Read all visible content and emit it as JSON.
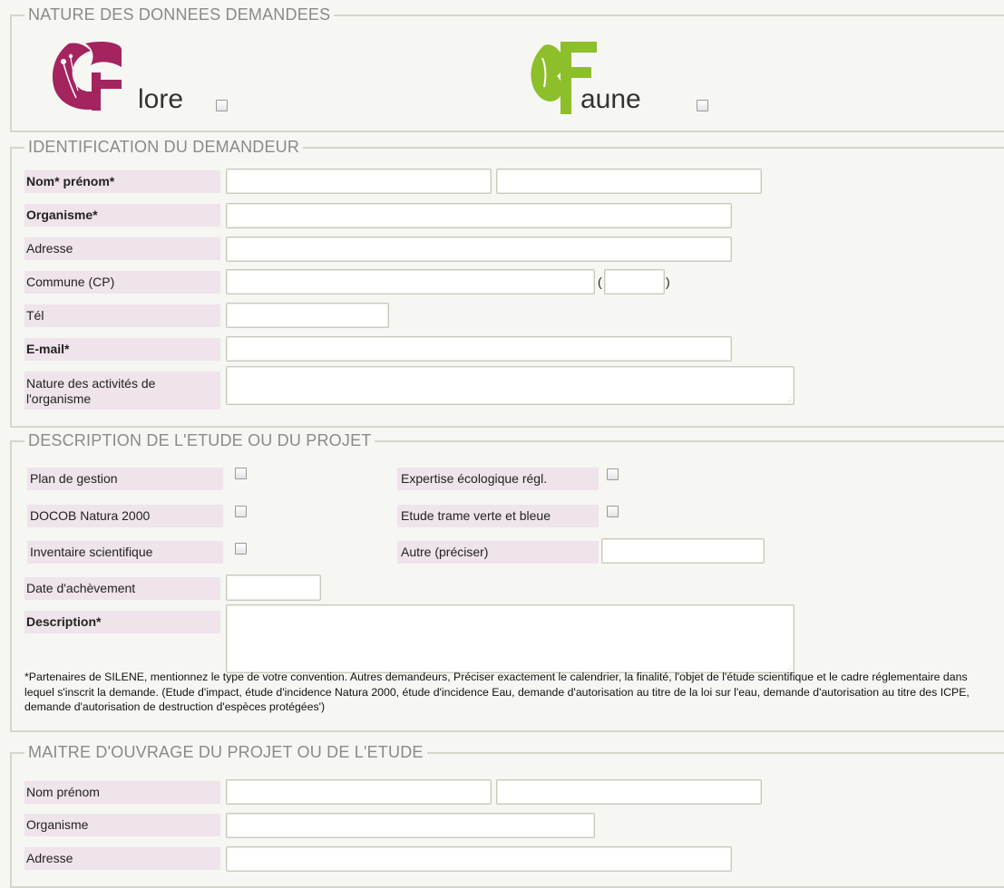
{
  "nature": {
    "legend": "NATURE DES DONNEES DEMANDEES",
    "flore_text": "lore",
    "faune_text": "aune",
    "flore_color": "#a3245e",
    "faune_color": "#8dbf2a"
  },
  "demandeur": {
    "legend": "IDENTIFICATION DU DEMANDEUR",
    "nom_prenom": "Nom* prénom*",
    "organisme": "Organisme*",
    "adresse": "Adresse",
    "commune": "Commune (CP)",
    "paren_open": "(",
    "paren_close": ")",
    "tel": "Tél",
    "email": "E-mail*",
    "nature_activites": "Nature des activités de l'organisme"
  },
  "description": {
    "legend": "DESCRIPTION DE L'ETUDE OU DU PROJET",
    "plan_gestion": "Plan de gestion",
    "docob": "DOCOB Natura 2000",
    "inventaire": "Inventaire scientifique",
    "expertise": "Expertise écologique régl.",
    "trame": "Etude trame verte et bleue",
    "autre": "Autre (préciser)",
    "date": "Date d'achèvement",
    "description": "Description*",
    "note": "*Partenaires de SILENE, mentionnez le type de votre convention. Autres demandeurs, Préciser exactement le calendrier, la finalité, l'objet de l'étude scientifique et le cadre réglementaire dans lequel s'inscrit la demande. (Etude d'impact, étude d'incidence Natura 2000, étude d'incidence Eau, demande d'autorisation au titre de la loi sur l'eau, demande d'autorisation au titre des ICPE, demande d'autorisation de destruction d'espèces protégées')"
  },
  "maitre": {
    "legend": "MAITRE D'OUVRAGE DU PROJET OU DE L'ETUDE",
    "nom_prenom": "Nom prénom",
    "organisme": "Organisme",
    "adresse": "Adresse"
  }
}
